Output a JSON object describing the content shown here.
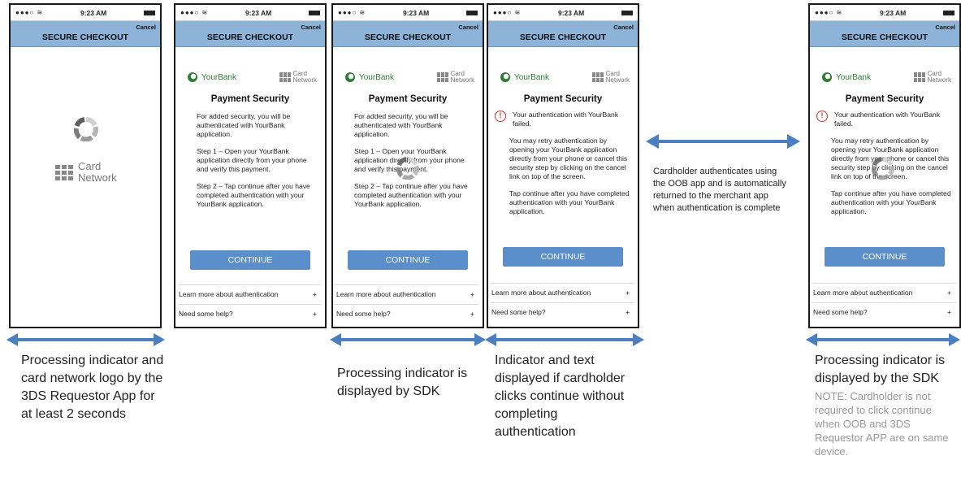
{
  "status_time": "9:23 AM",
  "header": {
    "cancel": "Cancel",
    "title": "SECURE CHECKOUT"
  },
  "logos": {
    "bank": "YourBank",
    "card_line1": "Card",
    "card_line2": "Network"
  },
  "payment_title": "Payment Security",
  "screen_intro": {
    "p1": "For added security, you will be authenticated with YourBank application.",
    "p2": "Step 1 – Open your YourBank application directly from your phone and verify this payment.",
    "p3": "Step 2 – Tap continue after you have completed authentication with your YourBank application."
  },
  "screen_failed": {
    "p1": "Your authentication with YourBank failed.",
    "p2": "You may retry authentication by opening your YourBank application directly from your phone or cancel this security step by clicking on the cancel link on top of the screen.",
    "p3": "Tap continue after you have completed authentication with your YourBank application."
  },
  "continue_label": "CONTINUE",
  "links": {
    "learn": "Learn more about authentication",
    "help": "Need some help?",
    "plus": "+"
  },
  "captions": {
    "c1": "Processing indicator and card network logo by the 3DS Requestor App for at least 2 seconds",
    "c3": "Processing indicator is displayed by SDK",
    "c4": "Indicator and text displayed if cardholder clicks continue without completing authentication",
    "c5": "Processing indicator is displayed by the SDK",
    "note": "NOTE: Cardholder is not required to click continue when OOB and 3DS Requestor APP are on same device.",
    "oob": "Cardholder authenticates using the OOB app and is automatically returned to the merchant app when authentication is complete"
  },
  "colors": {
    "header": "#8eb3d9",
    "button": "#5b8fcb",
    "arrow": "#4a7fc1",
    "error": "#d32f2f"
  }
}
